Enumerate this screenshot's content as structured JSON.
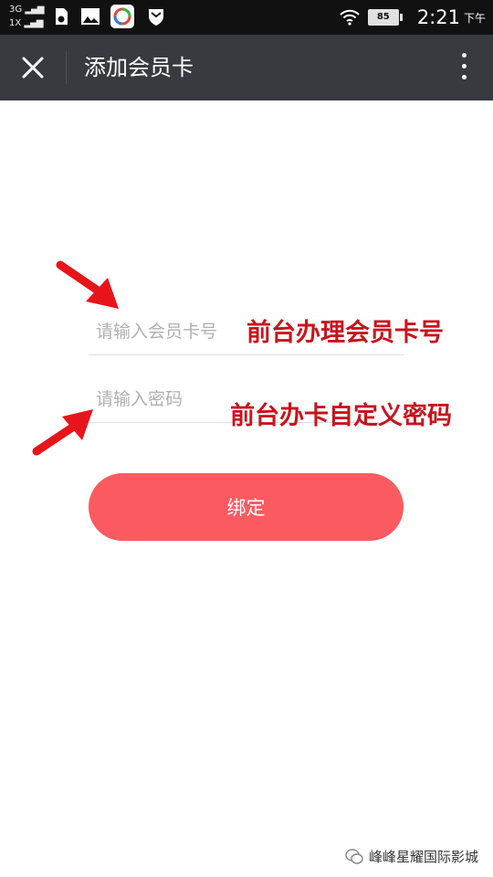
{
  "status_bar": {
    "network_top": "3G",
    "network_bottom": "1X",
    "battery": "85",
    "time": "2:21",
    "ampm": "下午",
    "icons": [
      "sim-card-icon",
      "image-icon",
      "app-icon",
      "shield-icon",
      "wifi-icon"
    ]
  },
  "title_bar": {
    "title": "添加会员卡",
    "close_icon": "close-icon",
    "more_icon": "more-vert-icon"
  },
  "form": {
    "card_number_placeholder": "请输入会员卡号",
    "password_placeholder": "请输入密码",
    "submit_label": "绑定"
  },
  "annotations": {
    "card_number_note": "前台办理会员卡号",
    "password_note": "前台办卡自定义密码"
  },
  "watermark": {
    "text": "峰峰星耀国际影城"
  },
  "colors": {
    "title_bar": "#393a3f",
    "button": "#fb5b60",
    "annotation": "#c8141e"
  }
}
